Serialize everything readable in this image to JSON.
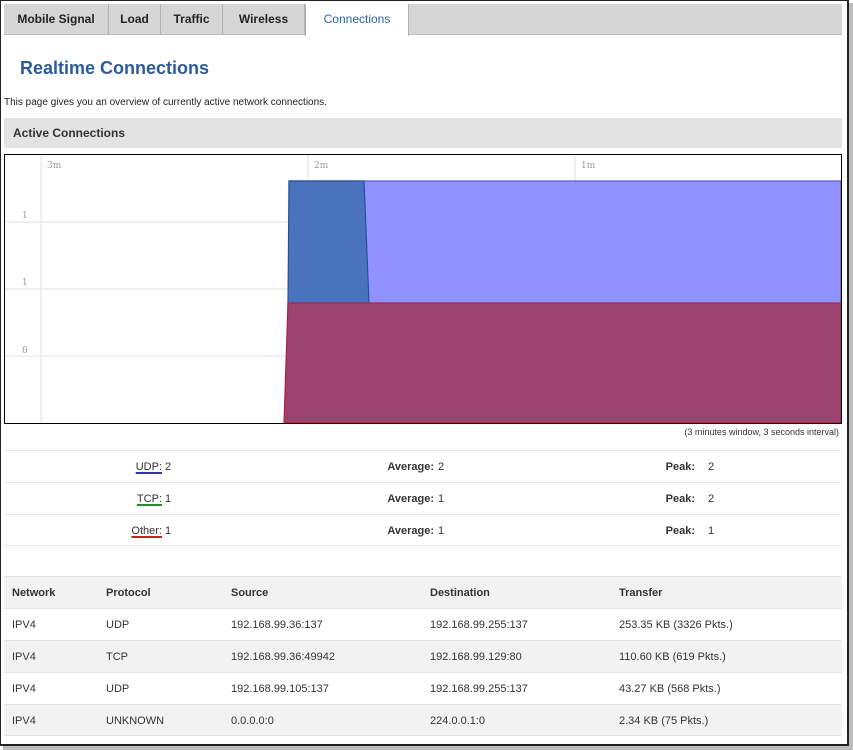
{
  "tabs": [
    {
      "label": "Mobile Signal",
      "active": false
    },
    {
      "label": "Load",
      "active": false
    },
    {
      "label": "Traffic",
      "active": false
    },
    {
      "label": "Wireless",
      "active": false
    },
    {
      "label": "Connections",
      "active": true
    }
  ],
  "page": {
    "title": "Realtime Connections",
    "description": "This page gives you an overview of currently active network connections."
  },
  "section": {
    "title": "Active Connections"
  },
  "graph": {
    "time_labels": [
      "3m",
      "2m",
      "1m"
    ],
    "y_labels": [
      "1",
      "1",
      "0"
    ],
    "note": "(3 minutes window, 3 seconds interval)",
    "colors": {
      "udp": "#9191ff",
      "udp_edge": "#5a5ae0",
      "tcp": "#4a73bd",
      "tcp_edge": "#2a4f9a",
      "other": "#9b4470",
      "other_edge": "#b02040"
    }
  },
  "chart_data": {
    "type": "area",
    "x_labels": [
      "3m",
      "2m",
      "1m"
    ],
    "series": [
      {
        "name": "UDP",
        "values": [
          0,
          2,
          2
        ]
      },
      {
        "name": "TCP",
        "values": [
          0,
          1,
          0
        ]
      },
      {
        "name": "Other",
        "values": [
          0,
          1,
          1
        ]
      }
    ]
  },
  "legend": [
    {
      "name": "UDP:",
      "value": "2",
      "avg_label": "Average:",
      "avg": "2",
      "peak_label": "Peak:",
      "peak": "2",
      "color": "#3333aa"
    },
    {
      "name": "TCP:",
      "value": "1",
      "avg_label": "Average:",
      "avg": "1",
      "peak_label": "Peak:",
      "peak": "2",
      "color": "#2a8a2a"
    },
    {
      "name": "Other:",
      "value": "1",
      "avg_label": "Average:",
      "avg": "1",
      "peak_label": "Peak:",
      "peak": "1",
      "color": "#cc2222"
    }
  ],
  "table": {
    "headers": [
      "Network",
      "Protocol",
      "Source",
      "Destination",
      "Transfer"
    ],
    "rows": [
      [
        "IPV4",
        "UDP",
        "192.168.99.36:137",
        "192.168.99.255:137",
        "253.35 KB (3326 Pkts.)"
      ],
      [
        "IPV4",
        "TCP",
        "192.168.99.36:49942",
        "192.168.99.129:80",
        "110.60 KB (619 Pkts.)"
      ],
      [
        "IPV4",
        "UDP",
        "192.168.99.105:137",
        "192.168.99.255:137",
        "43.27 KB (568 Pkts.)"
      ],
      [
        "IPV4",
        "UNKNOWN",
        "0.0.0.0:0",
        "224.0.0.1:0",
        "2.34 KB (75 Pkts.)"
      ]
    ]
  }
}
